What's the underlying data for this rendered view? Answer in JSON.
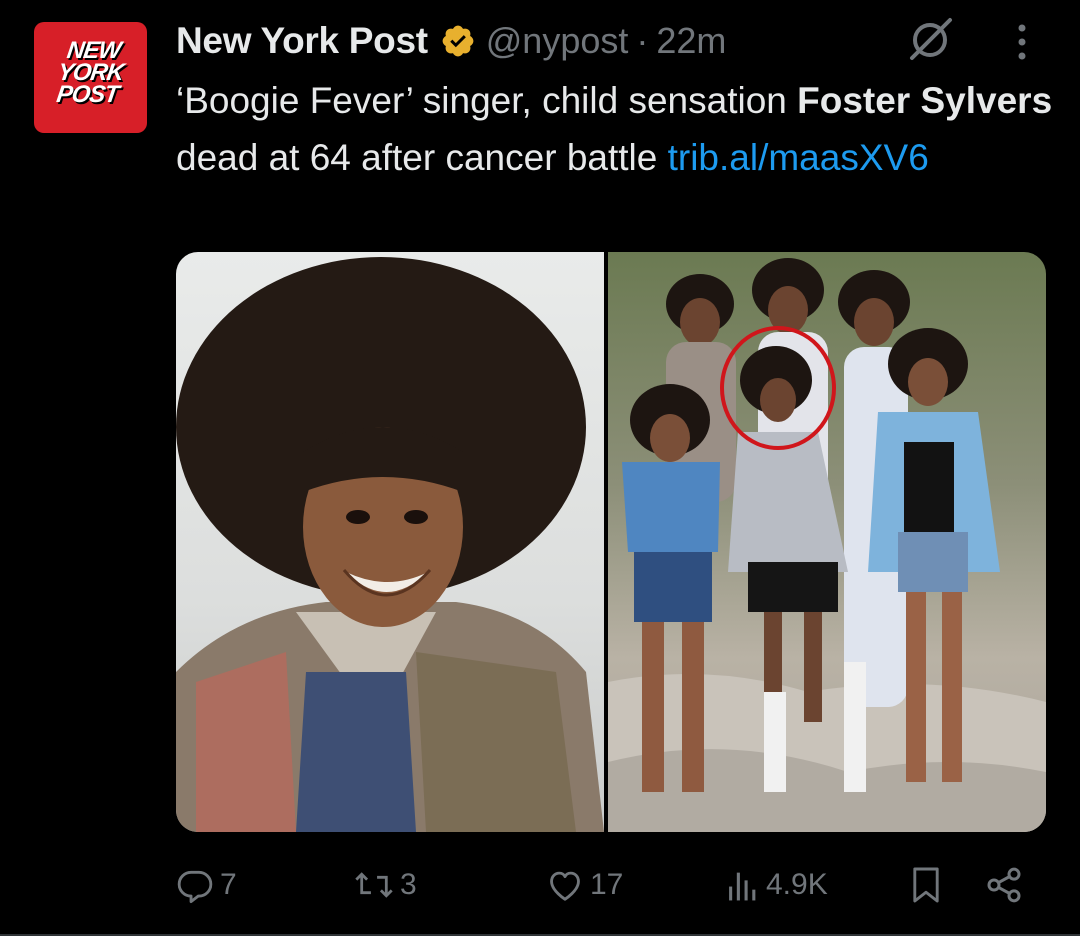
{
  "avatar": {
    "logo_text": "NEW\nYORK\nPOST",
    "bg_color": "#d71f28"
  },
  "header": {
    "display_name": "New York Post",
    "verified_badge_color": "#ffad1f",
    "handle": "@nypost",
    "separator": "·",
    "time": "22m"
  },
  "tweet": {
    "text_part1": "‘Boogie Fever’ singer, child sensation ",
    "bold_part": "Foster Sylvers",
    "text_part2": " dead at 64 after cancer battle ",
    "link_text": "trib.al/maasXV6",
    "link_color": "#1d9bf0"
  },
  "media": {
    "left_photo": "portrait-photo",
    "right_photo": "group-photo",
    "highlight_color": "#d0161b"
  },
  "actions": {
    "replies": "7",
    "reposts": "3",
    "likes": "17",
    "views": "4.9K"
  },
  "icons": {
    "reply": "reply-icon",
    "repost": "repost-icon",
    "like": "heart-icon",
    "views": "views-icon",
    "bookmark": "bookmark-icon",
    "share": "share-icon",
    "grok": "grok-icon",
    "more": "more-icon"
  }
}
